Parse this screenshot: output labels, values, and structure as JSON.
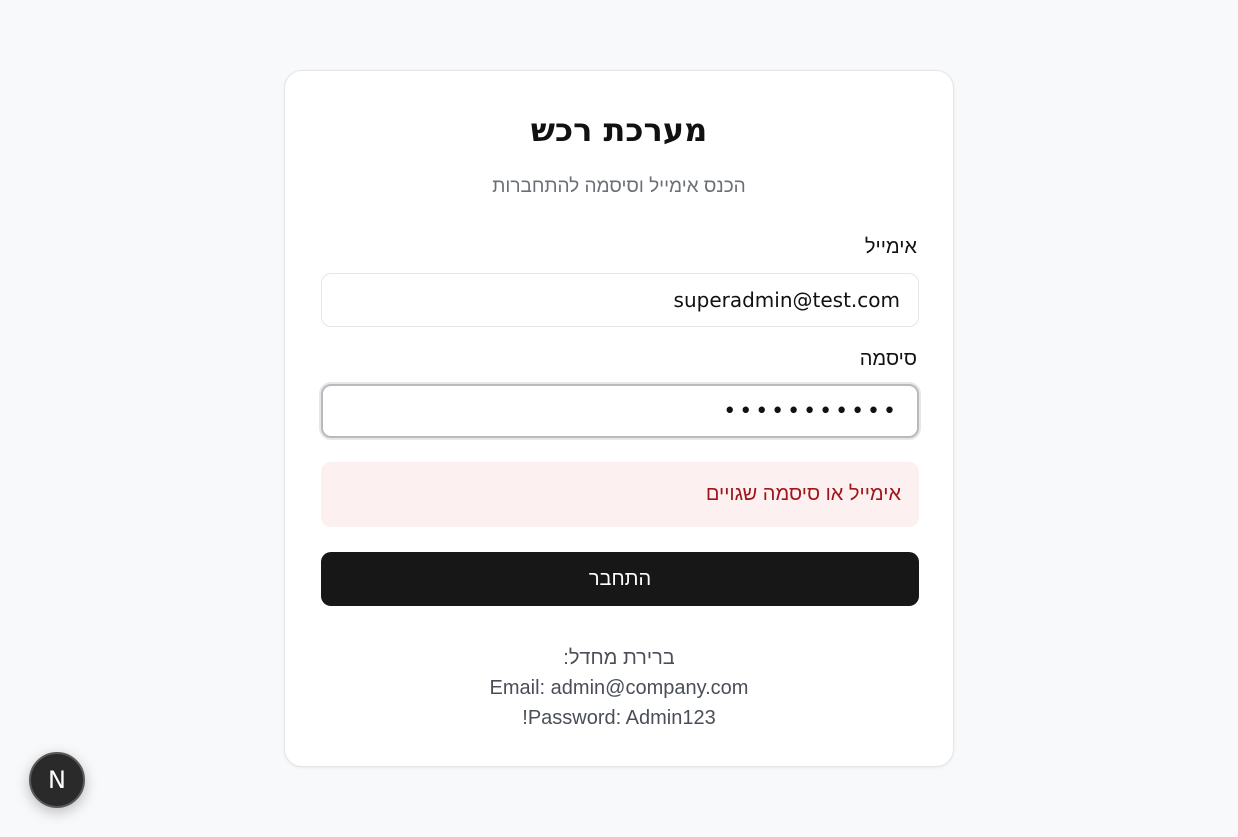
{
  "login": {
    "title": "מערכת רכש",
    "subtitle": "הכנס אימייל וסיסמה להתחברות",
    "email_label": "אימייל",
    "email_value": "superadmin@test.com",
    "password_label": "סיסמה",
    "password_value": "•••••••••••",
    "error_message": "אימייל או סיסמה שגויים",
    "submit_label": "התחבר",
    "hint_heading": "ברירת מחדל:",
    "hint_email": "Email: admin@company.com",
    "hint_password": "Password: Admin123!"
  },
  "badge": {
    "letter": "N"
  },
  "colors": {
    "background": "#f8f9fb",
    "button": "#171717",
    "error_bg": "#fdf0f0",
    "error_text": "#a1161b"
  }
}
